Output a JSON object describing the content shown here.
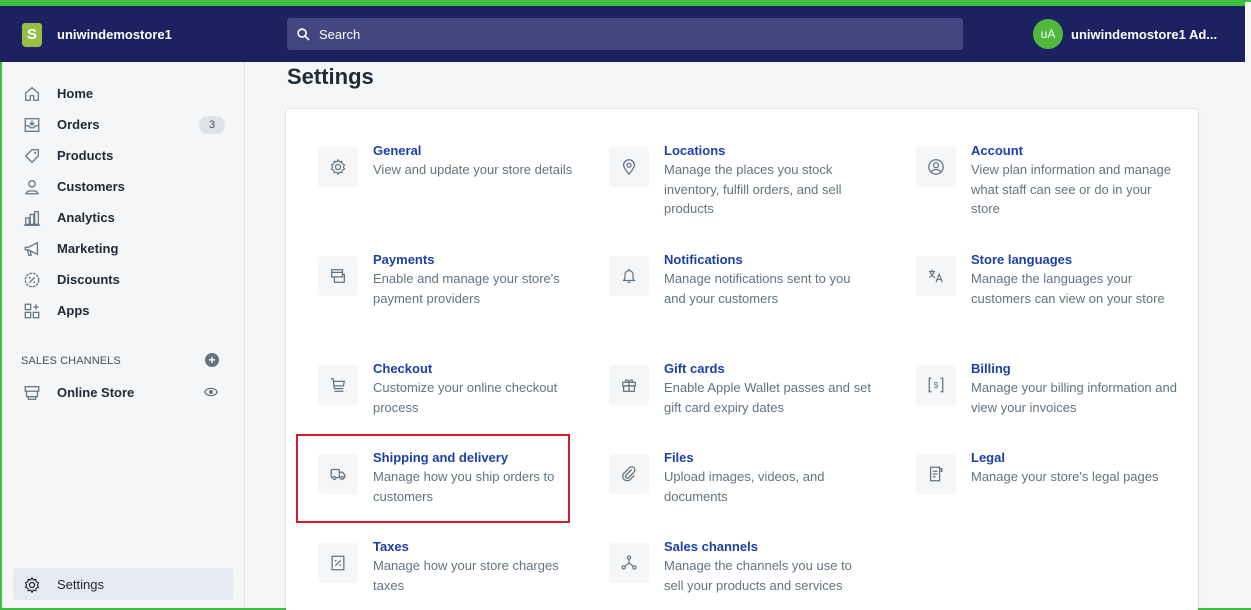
{
  "topbar": {
    "logo_letter": "S",
    "store_name": "uniwindemostore1",
    "search_placeholder": "Search",
    "user_initials": "uA",
    "user_name": "uniwindemostore1 Ad..."
  },
  "sidebar": {
    "items": [
      {
        "label": "Home",
        "icon": "home-icon"
      },
      {
        "label": "Orders",
        "icon": "orders-icon",
        "badge": "3"
      },
      {
        "label": "Products",
        "icon": "tag-icon"
      },
      {
        "label": "Customers",
        "icon": "person-icon"
      },
      {
        "label": "Analytics",
        "icon": "bar-chart-icon"
      },
      {
        "label": "Marketing",
        "icon": "megaphone-icon"
      },
      {
        "label": "Discounts",
        "icon": "discount-icon"
      },
      {
        "label": "Apps",
        "icon": "apps-icon"
      }
    ],
    "sales_channels_heading": "SALES CHANNELS",
    "online_store_label": "Online Store",
    "settings_label": "Settings"
  },
  "page": {
    "title": "Settings"
  },
  "settings": [
    {
      "title": "General",
      "desc": "View and update your store details",
      "icon": "gear-icon"
    },
    {
      "title": "Locations",
      "desc": "Manage the places you stock inventory, fulfill orders, and sell products",
      "icon": "location-pin-icon"
    },
    {
      "title": "Account",
      "desc": "View plan information and manage what staff can see or do in your store",
      "icon": "account-icon"
    },
    {
      "title": "Payments",
      "desc": "Enable and manage your store's payment providers",
      "icon": "payment-icon"
    },
    {
      "title": "Notifications",
      "desc": "Manage notifications sent to you and your customers",
      "icon": "bell-icon"
    },
    {
      "title": "Store languages",
      "desc": "Manage the languages your customers can view on your store",
      "icon": "translate-icon"
    },
    {
      "title": "Checkout",
      "desc": "Customize your online checkout process",
      "icon": "cart-icon"
    },
    {
      "title": "Gift cards",
      "desc": "Enable Apple Wallet passes and set gift card expiry dates",
      "icon": "gift-icon"
    },
    {
      "title": "Billing",
      "desc": "Manage your billing information and view your invoices",
      "icon": "billing-icon"
    },
    {
      "title": "Shipping and delivery",
      "desc": "Manage how you ship orders to customers",
      "icon": "truck-icon"
    },
    {
      "title": "Files",
      "desc": "Upload images, videos, and documents",
      "icon": "paperclip-icon"
    },
    {
      "title": "Legal",
      "desc": "Manage your store's legal pages",
      "icon": "legal-icon"
    },
    {
      "title": "Taxes",
      "desc": "Manage how your store charges taxes",
      "icon": "tax-icon"
    },
    {
      "title": "Sales channels",
      "desc": "Manage the channels you use to sell your products and services",
      "icon": "channels-icon"
    }
  ],
  "colors": {
    "topbar": "#1c2260",
    "link": "#1c3fa8",
    "highlight": "#cc2026",
    "frame": "#3fbf3f"
  }
}
